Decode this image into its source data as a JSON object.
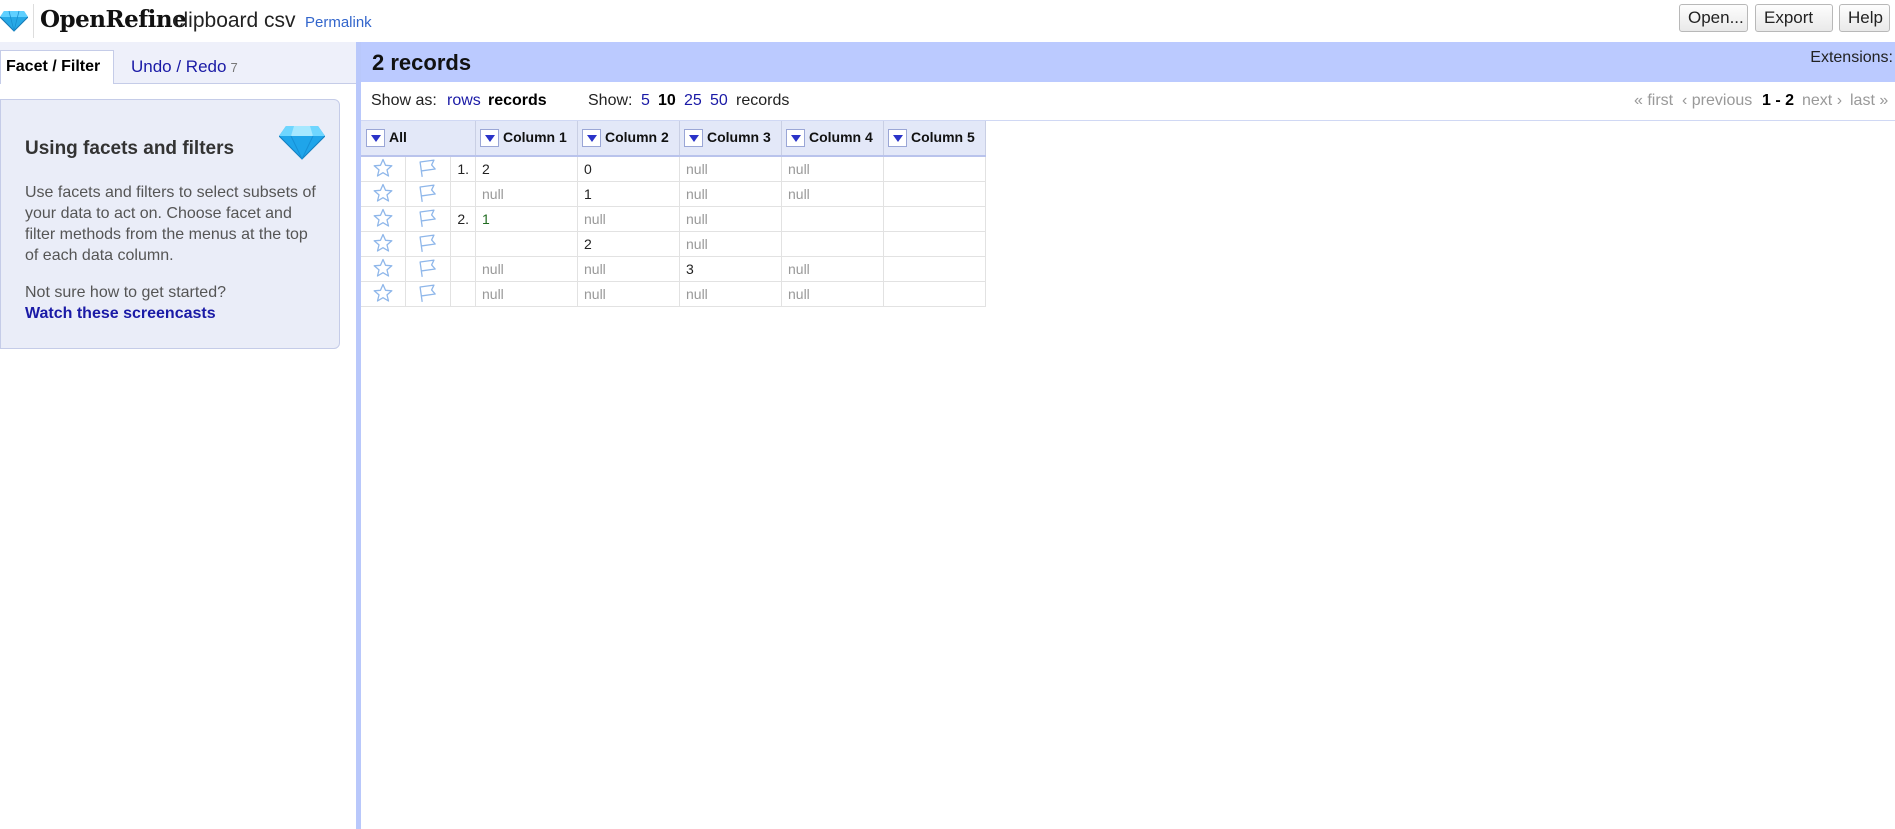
{
  "header": {
    "app_name": "OpenRefine",
    "project_name": "clipboard csv",
    "permalink": "Permalink",
    "open_label": "Open...",
    "export_label": "Export",
    "help_label": "Help"
  },
  "left_panel": {
    "tabs": {
      "facet": "Facet / Filter",
      "undo": "Undo / Redo",
      "undo_count": "7"
    },
    "help": {
      "title": "Using facets and filters",
      "body": "Use facets and filters to select subsets of your data to act on. Choose facet and filter methods from the menus at the top of each data column.",
      "question": "Not sure how to get started?",
      "link": "Watch these screencasts"
    }
  },
  "summary": {
    "records": "2 records",
    "extensions": "Extensions:"
  },
  "view_bar": {
    "show_as_label": "Show as:",
    "rows": "rows",
    "records": "records",
    "show_label": "Show:",
    "sizes": [
      "5",
      "10",
      "25",
      "50"
    ],
    "selected_size": "10",
    "records_suffix": "records",
    "pager": {
      "first": "« first",
      "previous": "‹ previous",
      "range": "1 - 2",
      "next": "next ›",
      "last": "last »"
    }
  },
  "table": {
    "all_label": "All",
    "columns": [
      "Column 1",
      "Column 2",
      "Column 3",
      "Column 4",
      "Column 5"
    ],
    "rows": [
      {
        "index": "1.",
        "cells": [
          "2",
          "0",
          "null",
          "null",
          ""
        ]
      },
      {
        "index": "",
        "cells": [
          "null",
          "1",
          "null",
          "null",
          ""
        ]
      },
      {
        "index": "2.",
        "cells": [
          "1",
          "null",
          "null",
          "",
          ""
        ]
      },
      {
        "index": "",
        "cells": [
          "",
          "2",
          "null",
          "",
          ""
        ]
      },
      {
        "index": "",
        "cells": [
          "null",
          "null",
          "3",
          "null",
          ""
        ]
      },
      {
        "index": "",
        "cells": [
          "null",
          "null",
          "null",
          "null",
          ""
        ]
      }
    ]
  },
  "colors": {
    "accent_blue": "#bbcaff",
    "link": "#1a1aa6",
    "null_text": "#999999"
  },
  "icons": [
    "diamond-logo-icon",
    "star-icon",
    "flag-icon",
    "dropdown-arrow-icon"
  ]
}
